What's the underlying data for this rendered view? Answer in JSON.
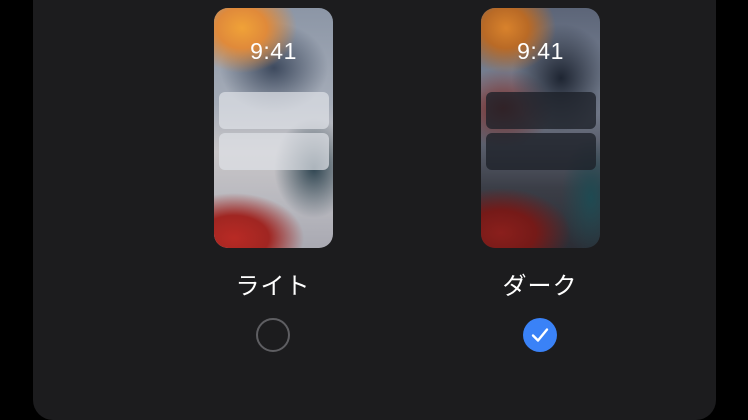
{
  "appearance": {
    "options": [
      {
        "label": "ライト",
        "preview_time": "9:41",
        "selected": false
      },
      {
        "label": "ダーク",
        "preview_time": "9:41",
        "selected": true
      }
    ],
    "colors": {
      "panel_background": "#1c1c1e",
      "selected_radio": "#3a82f7",
      "unselected_radio_border": "#5e5e62",
      "label_text": "#ffffff"
    },
    "icons": {
      "selected_indicator": "checkmark-icon"
    }
  }
}
